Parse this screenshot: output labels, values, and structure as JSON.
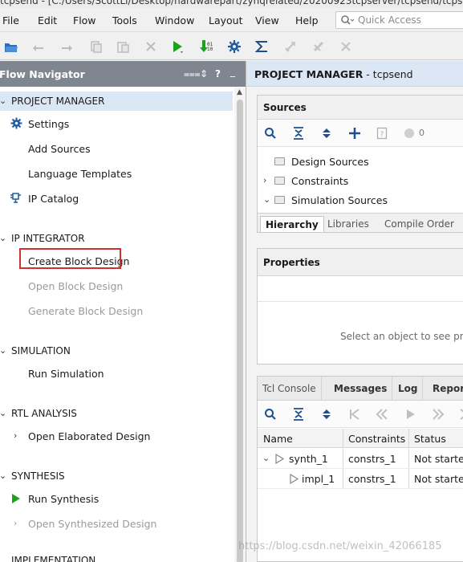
{
  "window": {
    "title": "tcpsend - [C:/Users/ScottLi/Desktop/hardwarepart/zynqrelated/20200923tcpserver/tcpsend/tcpsend"
  },
  "menubar": {
    "items": [
      "File",
      "Edit",
      "Flow",
      "Tools",
      "Window",
      "Layout",
      "View",
      "Help"
    ],
    "quick_access_placeholder": "Quick Access"
  },
  "toolbar": {
    "icons": [
      "open-icon",
      "undo-icon",
      "redo-icon",
      "copy-icon",
      "paste-icon",
      "delete-icon",
      "run-icon",
      "program-device-icon",
      "settings-icon",
      "sigma-icon",
      "cancel-run-icon",
      "clear-icon",
      "close-icon"
    ]
  },
  "flow_navigator": {
    "title": "Flow Navigator",
    "sections": {
      "project_manager": {
        "label": "PROJECT MANAGER",
        "items": [
          "Settings",
          "Add Sources",
          "Language Templates",
          "IP Catalog"
        ]
      },
      "ip_integrator": {
        "label": "IP INTEGRATOR",
        "items": [
          "Create Block Design",
          "Open Block Design",
          "Generate Block Design"
        ]
      },
      "simulation": {
        "label": "SIMULATION",
        "items": [
          "Run Simulation"
        ]
      },
      "rtl_analysis": {
        "label": "RTL ANALYSIS",
        "items": [
          "Open Elaborated Design"
        ]
      },
      "synthesis": {
        "label": "SYNTHESIS",
        "items": [
          "Run Synthesis",
          "Open Synthesized Design"
        ]
      },
      "implementation": {
        "label": "IMPLEMENTATION"
      }
    }
  },
  "project_manager_pane": {
    "title": "PROJECT MANAGER",
    "project": "tcpsend"
  },
  "sources": {
    "title": "Sources",
    "count": "0",
    "tree": [
      "Design Sources",
      "Constraints",
      "Simulation Sources"
    ],
    "tabs": [
      "Hierarchy",
      "Libraries",
      "Compile Order"
    ]
  },
  "properties": {
    "title": "Properties",
    "empty_text": "Select an object to see prop"
  },
  "console": {
    "tabs": [
      "Tcl Console",
      "Messages",
      "Log",
      "Reports"
    ],
    "columns": [
      "Name",
      "Constraints",
      "Status"
    ],
    "rows": [
      {
        "name": "synth_1",
        "constraints": "constrs_1",
        "status": "Not started"
      },
      {
        "name": "impl_1",
        "constraints": "constrs_1",
        "status": "Not started"
      }
    ]
  },
  "watermark": "https://blog.csdn.net/weixin_42066185",
  "colors": {
    "header_gray": "#7f8690",
    "section_blue": "#dce7f5",
    "highlight_red": "#d03030",
    "run_green": "#1ea21e"
  }
}
